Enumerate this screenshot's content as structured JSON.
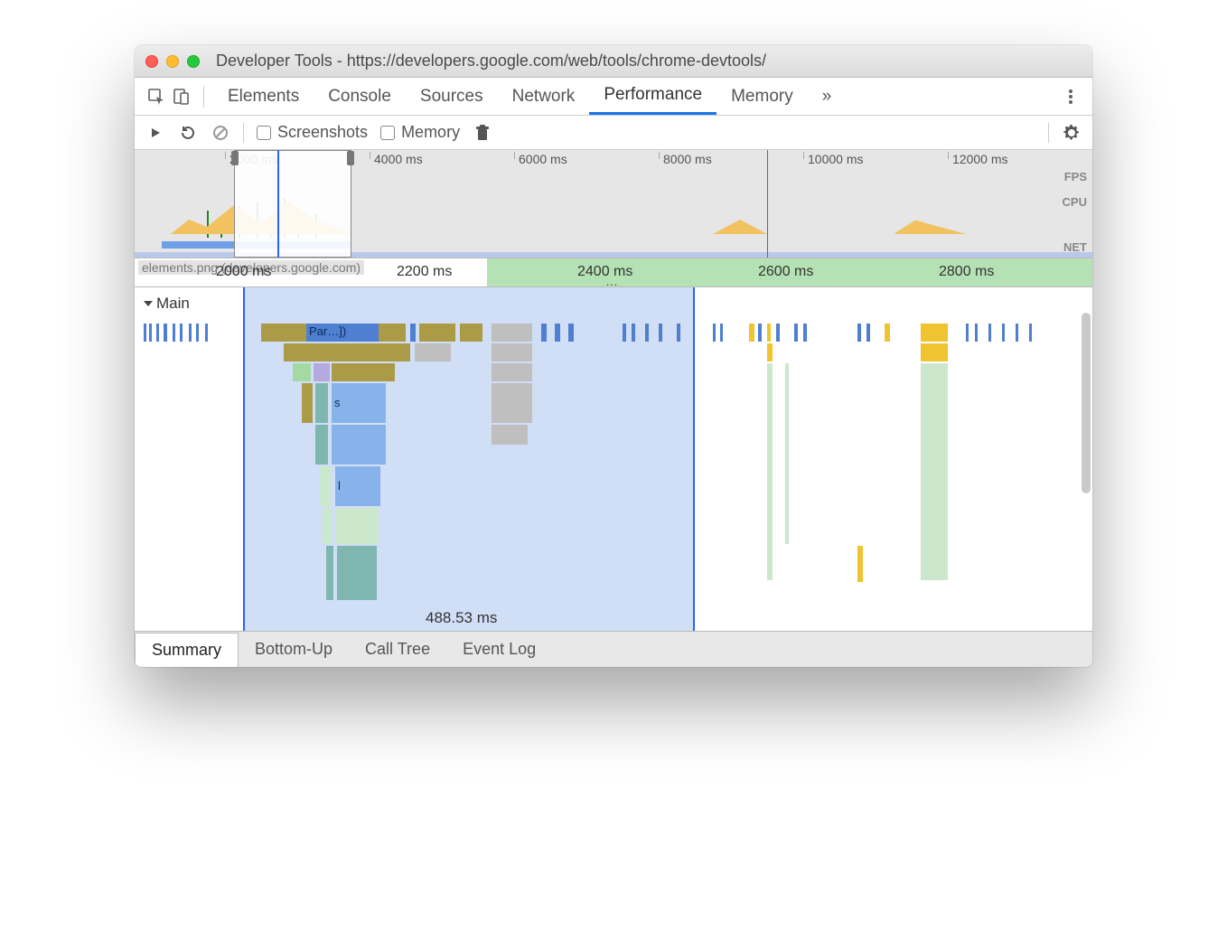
{
  "window": {
    "title": "Developer Tools - https://developers.google.com/web/tools/chrome-devtools/"
  },
  "tabs": {
    "items": [
      "Elements",
      "Console",
      "Sources",
      "Network",
      "Performance",
      "Memory"
    ],
    "active": "Performance",
    "overflow": "»"
  },
  "toolbar": {
    "screenshots_label": "Screenshots",
    "memory_label": "Memory"
  },
  "overview": {
    "ticks": [
      "2000 ms",
      "4000 ms",
      "6000 ms",
      "8000 ms",
      "10000 ms",
      "12000 ms"
    ],
    "labels": {
      "fps": "FPS",
      "cpu": "CPU",
      "net": "NET"
    }
  },
  "ruler": {
    "net_label": "elements.png (developers.google.com)",
    "ticks": [
      "2000 ms",
      "2200 ms",
      "2400 ms",
      "2600 ms",
      "2800 ms"
    ],
    "ellipsis": "…"
  },
  "flame": {
    "track_label": "Main",
    "selection_duration": "488.53 ms",
    "bar_labels": {
      "parse": "Par…])",
      "s": "s",
      "l": "l"
    }
  },
  "bottom_tabs": {
    "items": [
      "Summary",
      "Bottom-Up",
      "Call Tree",
      "Event Log"
    ],
    "active": "Summary"
  }
}
